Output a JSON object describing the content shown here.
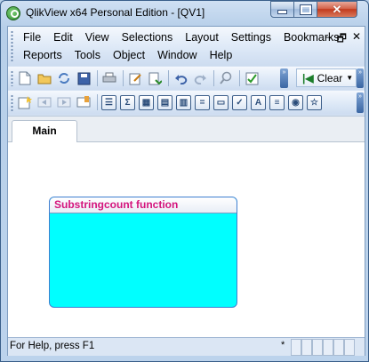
{
  "window": {
    "title": "QlikView x64 Personal Edition - [QV1]",
    "controls": {
      "minimize": "",
      "maximize": "",
      "close": "✕"
    }
  },
  "menubar": {
    "row1": [
      "File",
      "Edit",
      "View",
      "Selections",
      "Layout",
      "Settings",
      "Bookmarks"
    ],
    "row2": [
      "Reports",
      "Tools",
      "Object",
      "Window",
      "Help"
    ],
    "mdi_controls": [
      "–",
      "🗗",
      "✕"
    ]
  },
  "toolbar1": {
    "icons": [
      "new-doc-icon",
      "open-folder-icon",
      "reload-icon",
      "save-icon",
      "print-icon",
      "edit-script-icon",
      "reload-data-icon",
      "undo-icon",
      "redo-icon",
      "search-icon",
      "checkmark-icon"
    ],
    "clear_label": "Clear"
  },
  "toolbar2": {
    "icons": [
      "new-sheet-icon",
      "back-icon",
      "forward-icon",
      "bookmark-icon",
      "listbox-icon",
      "statistics-box-icon",
      "table-box-icon",
      "multi-box-icon",
      "chart-icon",
      "input-box-icon",
      "button-icon",
      "current-selections-icon",
      "text-object-icon",
      "line-arrow-icon",
      "slider-icon",
      "bookmark-object-icon"
    ]
  },
  "sheet": {
    "tabs": [
      "Main"
    ],
    "text_object": {
      "caption": "Substringcount function",
      "background": "#00FFFF",
      "caption_color": "#D4147D"
    }
  },
  "statusbar": {
    "help_text": "For Help, press F1",
    "indicator": "*"
  }
}
